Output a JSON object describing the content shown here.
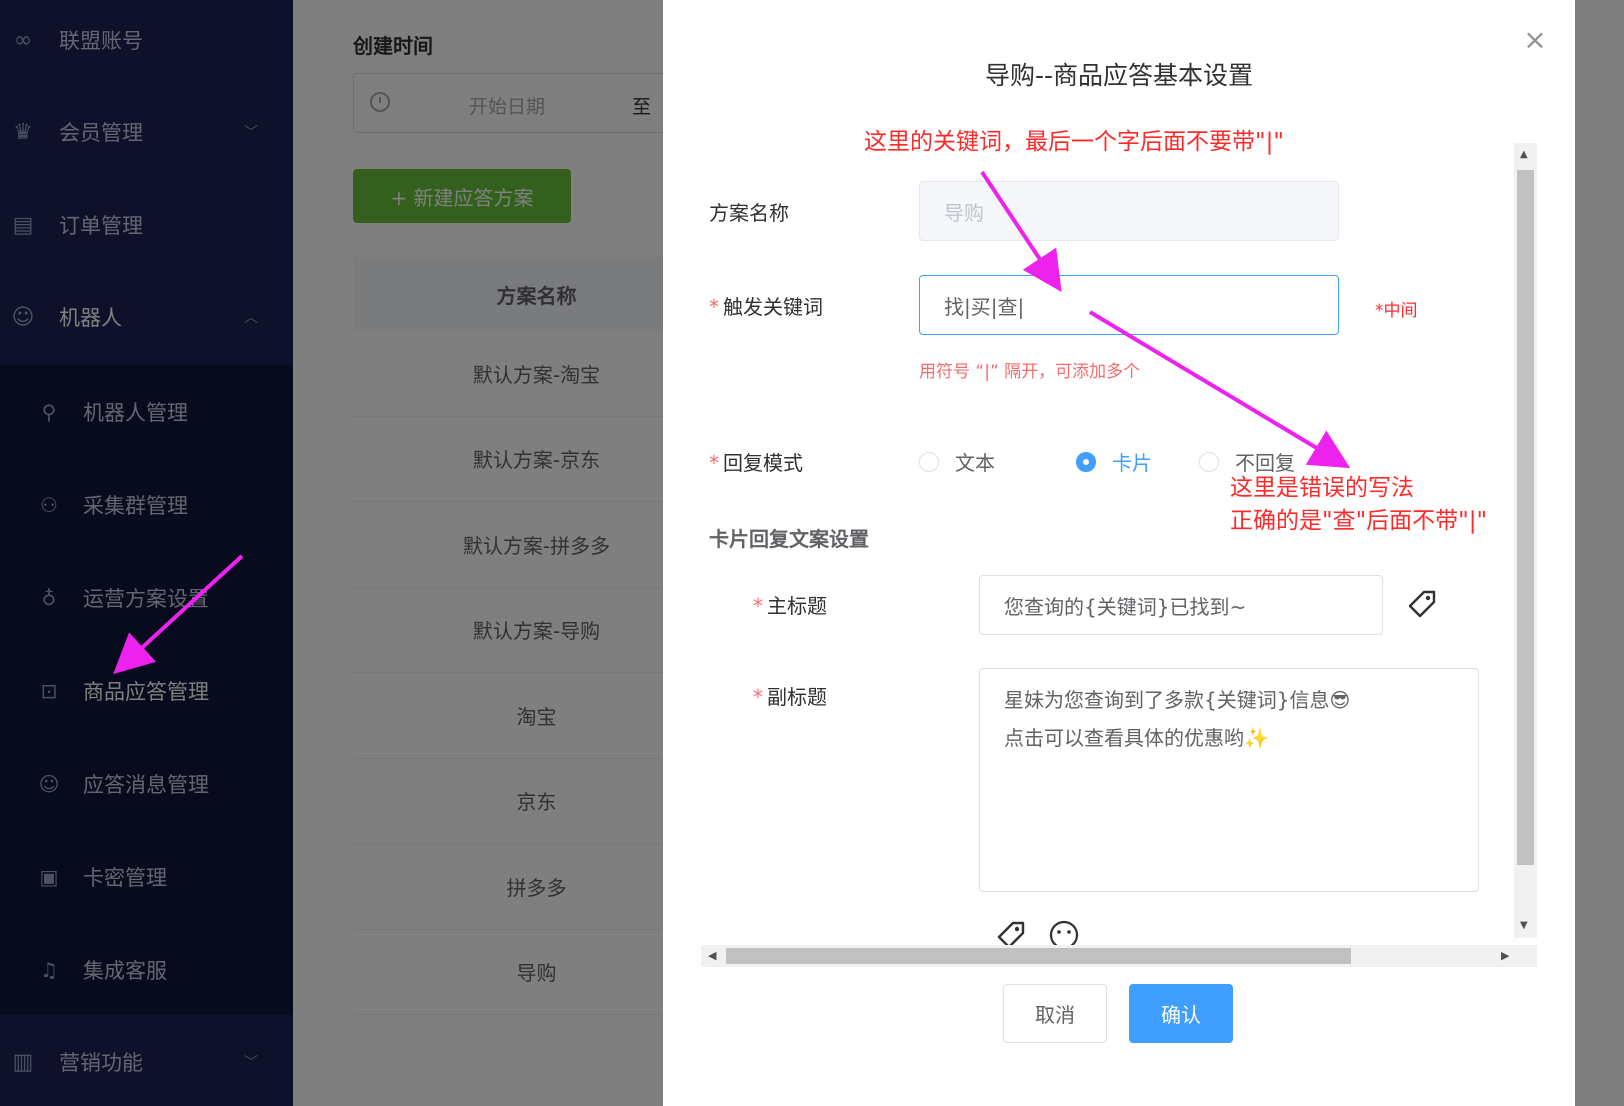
{
  "sidebar": {
    "items": [
      {
        "label": "联盟账号",
        "icon": "infinity-icon"
      },
      {
        "label": "会员管理",
        "icon": "crown-icon"
      },
      {
        "label": "订单管理",
        "icon": "order-icon"
      },
      {
        "label": "机器人",
        "icon": "robot-icon"
      }
    ],
    "sub_items": [
      {
        "label": "机器人管理",
        "icon": "wrench-icon"
      },
      {
        "label": "采集群管理",
        "icon": "group-icon"
      },
      {
        "label": "运营方案设置",
        "icon": "bulb-icon"
      },
      {
        "label": "商品应答管理",
        "icon": "bag-icon"
      },
      {
        "label": "应答消息管理",
        "icon": "smile-icon"
      },
      {
        "label": "卡密管理",
        "icon": "card-icon"
      },
      {
        "label": "集成客服",
        "icon": "headset-icon"
      }
    ],
    "bottom_item": {
      "label": "营销功能",
      "icon": "chart-icon"
    }
  },
  "filter": {
    "created_label": "创建时间",
    "start_placeholder": "开始日期",
    "range_separator": "至"
  },
  "new_button": "+ 新建应答方案",
  "table": {
    "header": "方案名称",
    "rows": [
      "默认方案-淘宝",
      "默认方案-京东",
      "默认方案-拼多多",
      "默认方案-导购",
      "淘宝",
      "京东",
      "拼多多",
      "导购"
    ]
  },
  "dialog": {
    "title": "导购--商品应答基本设置",
    "name_label": "方案名称",
    "name_value": "导购",
    "keyword_label": "触发关键词",
    "keyword_value": "找|买|查|",
    "keyword_side_note": "*中间",
    "keyword_hint": "用符号 “|” 隔开，可添加多个",
    "reply_mode_label": "回复模式",
    "reply_modes": [
      "文本",
      "卡片",
      "不回复"
    ],
    "reply_mode_selected": "卡片",
    "card_section_title": "卡片回复文案设置",
    "main_title_label": "主标题",
    "main_title_value": "您查询的{关键词}已找到~",
    "subtitle_label": "副标题",
    "subtitle_lines": [
      "星妹为您查询到了多款{关键词}信息😎",
      "点击可以查看具体的优惠哟✨"
    ],
    "cancel_label": "取消",
    "confirm_label": "确认"
  },
  "annotations": {
    "top_note": "这里的关键词，最后一个字后面不要带\"|\"",
    "error_line1": "这里是错误的写法",
    "error_line2": "正确的是\"查\"后面不带\"|\""
  },
  "colors": {
    "sidebar_bg": "#1e2255",
    "sidebar_sub_bg": "#10143d",
    "primary": "#409eff",
    "success": "#67c23a",
    "danger": "#f56c6c",
    "annotation_red": "#ff2a2a",
    "arrow_magenta": "#ee22ee"
  }
}
